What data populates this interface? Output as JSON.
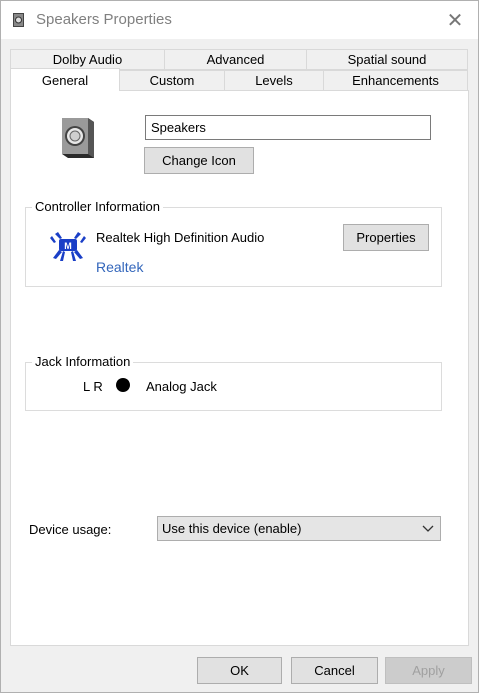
{
  "window": {
    "title": "Speakers Properties",
    "close_glyph": "✕"
  },
  "tabs_row1": [
    {
      "label": "Dolby Audio"
    },
    {
      "label": "Advanced"
    },
    {
      "label": "Spatial sound"
    }
  ],
  "tabs_row2": [
    {
      "label": "General",
      "active": true
    },
    {
      "label": "Custom"
    },
    {
      "label": "Levels"
    },
    {
      "label": "Enhancements"
    }
  ],
  "general": {
    "device_name": "Speakers",
    "change_icon_label": "Change Icon",
    "controller": {
      "legend": "Controller Information",
      "name": "Realtek High Definition Audio",
      "manufacturer_link": "Realtek",
      "properties_label": "Properties"
    },
    "jack": {
      "legend": "Jack Information",
      "channels": "L R",
      "type": "Analog Jack"
    },
    "device_usage": {
      "label": "Device usage:",
      "selected": "Use this device (enable)"
    }
  },
  "footer": {
    "ok_label": "OK",
    "cancel_label": "Cancel",
    "apply_label": "Apply"
  },
  "colors": {
    "link": "#3366bb",
    "realtek_blue": "#1a3fc7"
  }
}
